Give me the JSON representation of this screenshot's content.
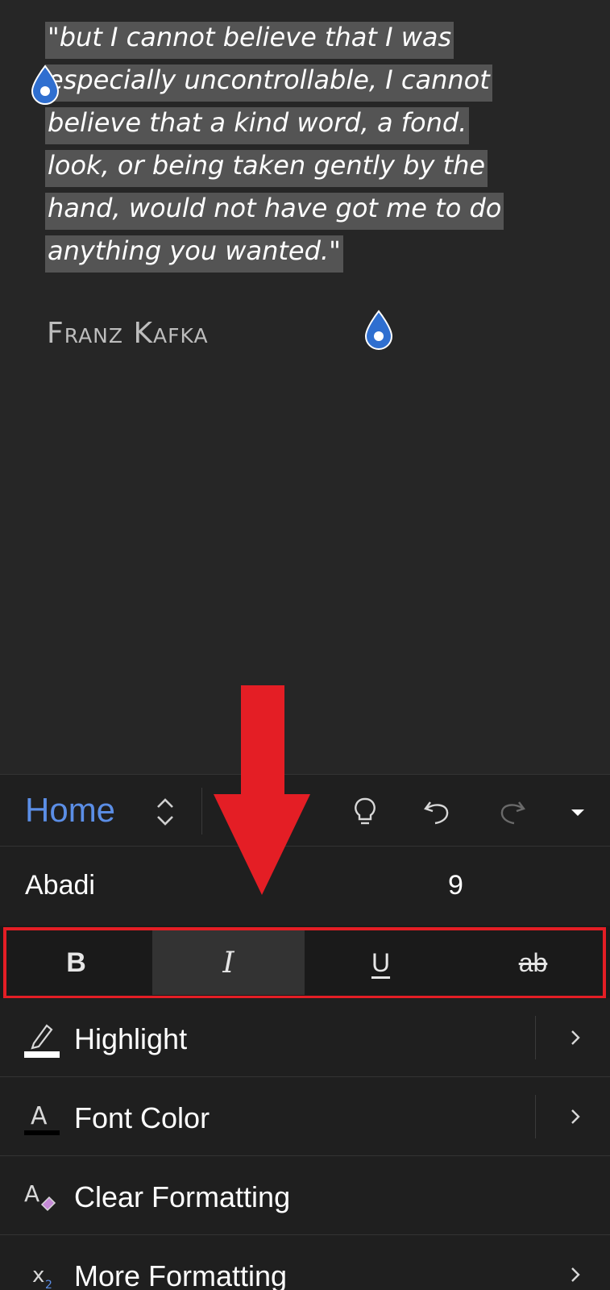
{
  "document": {
    "quote_lines": [
      "\"but I cannot believe that I was",
      "especially uncontrollable, I cannot",
      "believe that a kind word, a fond.",
      "look, or being taken gently by the",
      "hand, would not have got me to do",
      "anything you wanted.\""
    ],
    "author": "Franz Kafka",
    "selection_color": "#545454",
    "handle_color": "#2f6fd0"
  },
  "ribbon": {
    "tab_label": "Home",
    "tab_switch_icon": "chevron-up-down-icon",
    "toolbar_icons": [
      "lightbulb-icon",
      "undo-icon",
      "redo-icon",
      "caret-down-icon"
    ],
    "accent_color": "#5b8ee6"
  },
  "font": {
    "name": "Abadi",
    "size": "9"
  },
  "text_styles": {
    "bold": "B",
    "italic": "I",
    "underline": "U",
    "strikethrough": "ab",
    "active": "italic"
  },
  "menu": {
    "highlight": "Highlight",
    "font_color": "Font Color",
    "clear_formatting": "Clear Formatting",
    "more_formatting": "More Formatting"
  },
  "annotation": {
    "color": "#e41e25"
  }
}
